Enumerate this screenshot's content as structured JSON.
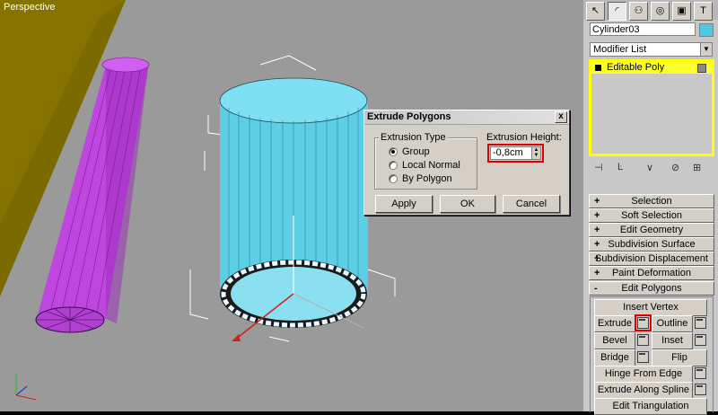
{
  "viewport": {
    "label": "Perspective"
  },
  "dialog": {
    "title": "Extrude Polygons",
    "close_glyph": "x",
    "group_title": "Extrusion Type",
    "options": [
      "Group",
      "Local Normal",
      "By Polygon"
    ],
    "selected_option": "Group",
    "height_label": "Extrusion Height:",
    "height_value": "-0,8cm",
    "buttons": {
      "apply": "Apply",
      "ok": "OK",
      "cancel": "Cancel"
    }
  },
  "panel": {
    "object_name": "Cylinder03",
    "object_color": "#4fc8e8",
    "modifier_list": "Modifier List",
    "stack_item": "Editable Poly",
    "rollouts": [
      {
        "sign": "+",
        "label": "Selection"
      },
      {
        "sign": "+",
        "label": "Soft Selection"
      },
      {
        "sign": "+",
        "label": "Edit Geometry"
      },
      {
        "sign": "+",
        "label": "Subdivision Surface"
      },
      {
        "sign": "+",
        "label": "Subdivision Displacement"
      },
      {
        "sign": "+",
        "label": "Paint Deformation"
      },
      {
        "sign": "-",
        "label": "Edit Polygons"
      }
    ],
    "edit_polygons": {
      "insert_vertex": "Insert Vertex",
      "extrude": "Extrude",
      "outline": "Outline",
      "bevel": "Bevel",
      "inset": "Inset",
      "bridge": "Bridge",
      "flip": "Flip",
      "hinge_from_edge": "Hinge From Edge",
      "extrude_along_spline": "Extrude Along Spline",
      "edit_triangulation": "Edit Triangulation"
    }
  },
  "colors": {
    "highlight": "#e00000",
    "selection": "#ffff00",
    "cylinder": "#5ccfe6",
    "tube": "#c040e0"
  }
}
